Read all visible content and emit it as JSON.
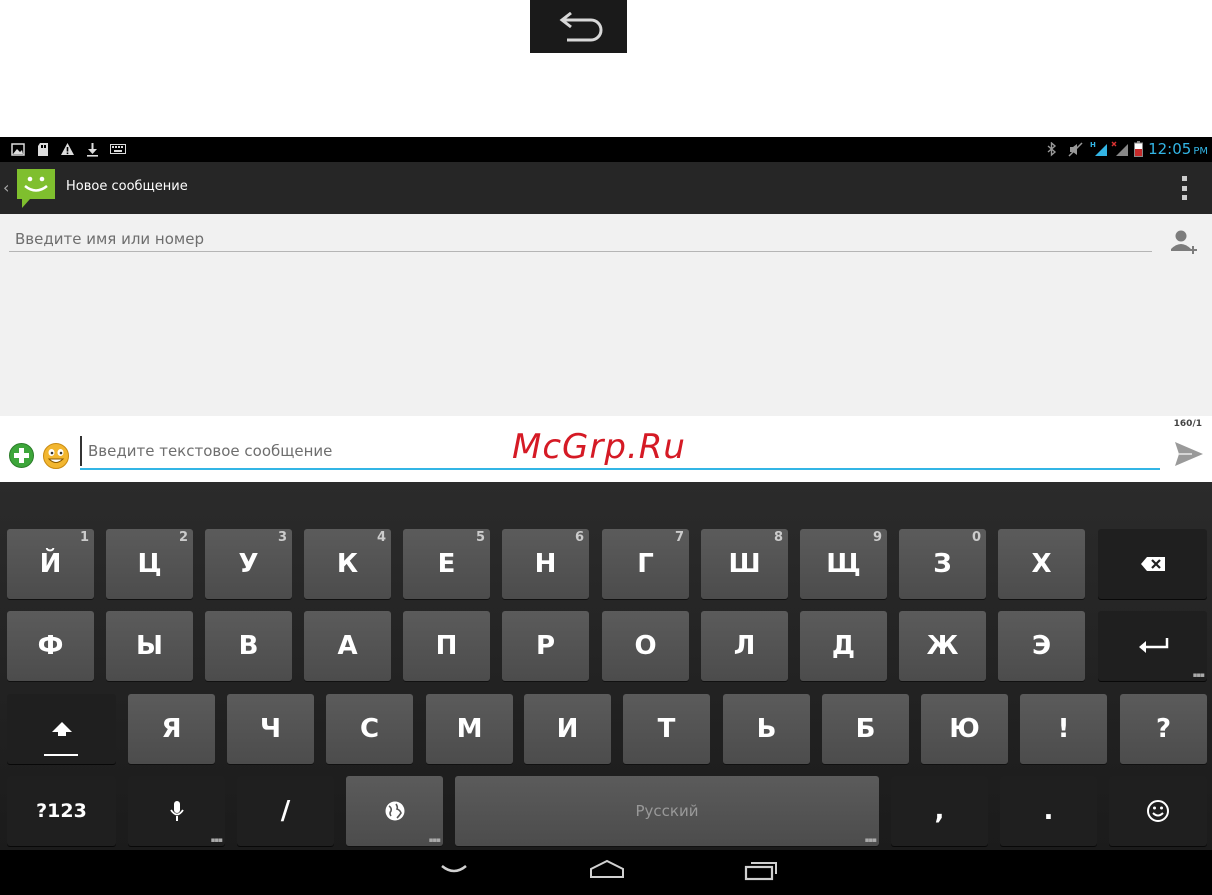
{
  "status_bar": {
    "notification_icons": [
      "gallery-icon",
      "sd-card-icon",
      "warning-icon",
      "download-icon",
      "keyboard-icon"
    ],
    "system_icons": [
      "bluetooth-icon",
      "mute-icon",
      "signal-h-icon",
      "signal-x-icon",
      "battery-icon"
    ],
    "time": "12:05",
    "ampm": "PM"
  },
  "action_bar": {
    "title": "Новое сообщение"
  },
  "recipient": {
    "placeholder": "Введите имя или номер"
  },
  "compose": {
    "placeholder": "Введите текстовое сообщение",
    "counter": "160/1"
  },
  "watermark": "McGrp.Ru",
  "keyboard": {
    "row1": [
      {
        "label": "Й",
        "hint": "1"
      },
      {
        "label": "Ц",
        "hint": "2"
      },
      {
        "label": "У",
        "hint": "3"
      },
      {
        "label": "К",
        "hint": "4"
      },
      {
        "label": "Е",
        "hint": "5"
      },
      {
        "label": "Н",
        "hint": "6"
      },
      {
        "label": "Г",
        "hint": "7"
      },
      {
        "label": "Ш",
        "hint": "8"
      },
      {
        "label": "Щ",
        "hint": "9"
      },
      {
        "label": "З",
        "hint": "0"
      },
      {
        "label": "Х",
        "hint": ""
      }
    ],
    "row2": [
      "Ф",
      "Ы",
      "В",
      "А",
      "П",
      "Р",
      "О",
      "Л",
      "Д",
      "Ж",
      "Э"
    ],
    "row3": [
      "Я",
      "Ч",
      "С",
      "М",
      "И",
      "Т",
      "Ь",
      "Б",
      "Ю",
      "!",
      "?"
    ],
    "symbols_label": "?123",
    "slash_label": "/",
    "space_label": "Русский",
    "comma_label": ",",
    "period_label": "."
  },
  "colors": {
    "accent": "#33b5e5",
    "watermark": "#d51a25",
    "action_bar": "#262626",
    "content_bg": "#f1f1f1"
  }
}
